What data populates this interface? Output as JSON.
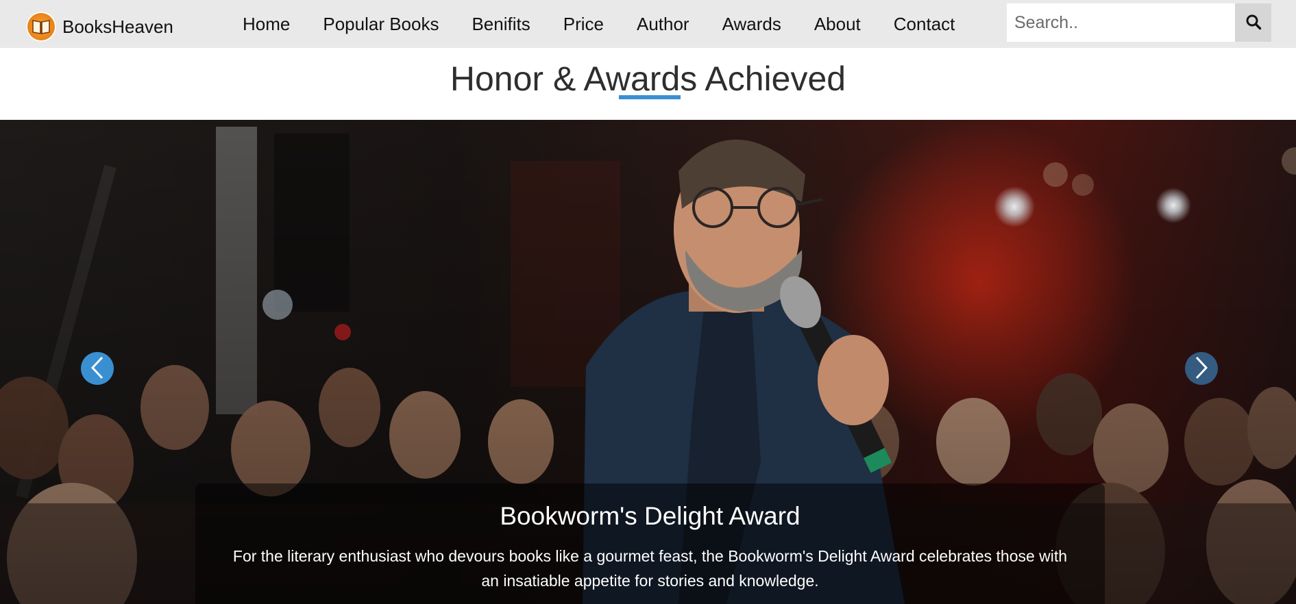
{
  "brand": {
    "name": "BooksHeaven",
    "logo_icon": "open-book-icon"
  },
  "nav": {
    "links": [
      "Home",
      "Popular Books",
      "Benifits",
      "Price",
      "Author",
      "Awards",
      "About",
      "Contact"
    ]
  },
  "search": {
    "placeholder": "Search..",
    "value": "",
    "button_icon": "search-icon"
  },
  "section": {
    "title": "Honor & Awards Achieved"
  },
  "carousel": {
    "active_slide": {
      "title": "Bookworm's Delight Award",
      "text": "For the literary enthusiast who devours books like a gourmet feast, the Bookworm's Delight Award celebrates those with an insatiable appetite for stories and knowledge."
    },
    "prev_icon": "chevron-left-icon",
    "next_icon": "chevron-right-icon"
  },
  "colors": {
    "navbar_bg": "#e9e9e9",
    "accent": "#3a8fd1",
    "heading": "#2e2e2e"
  }
}
